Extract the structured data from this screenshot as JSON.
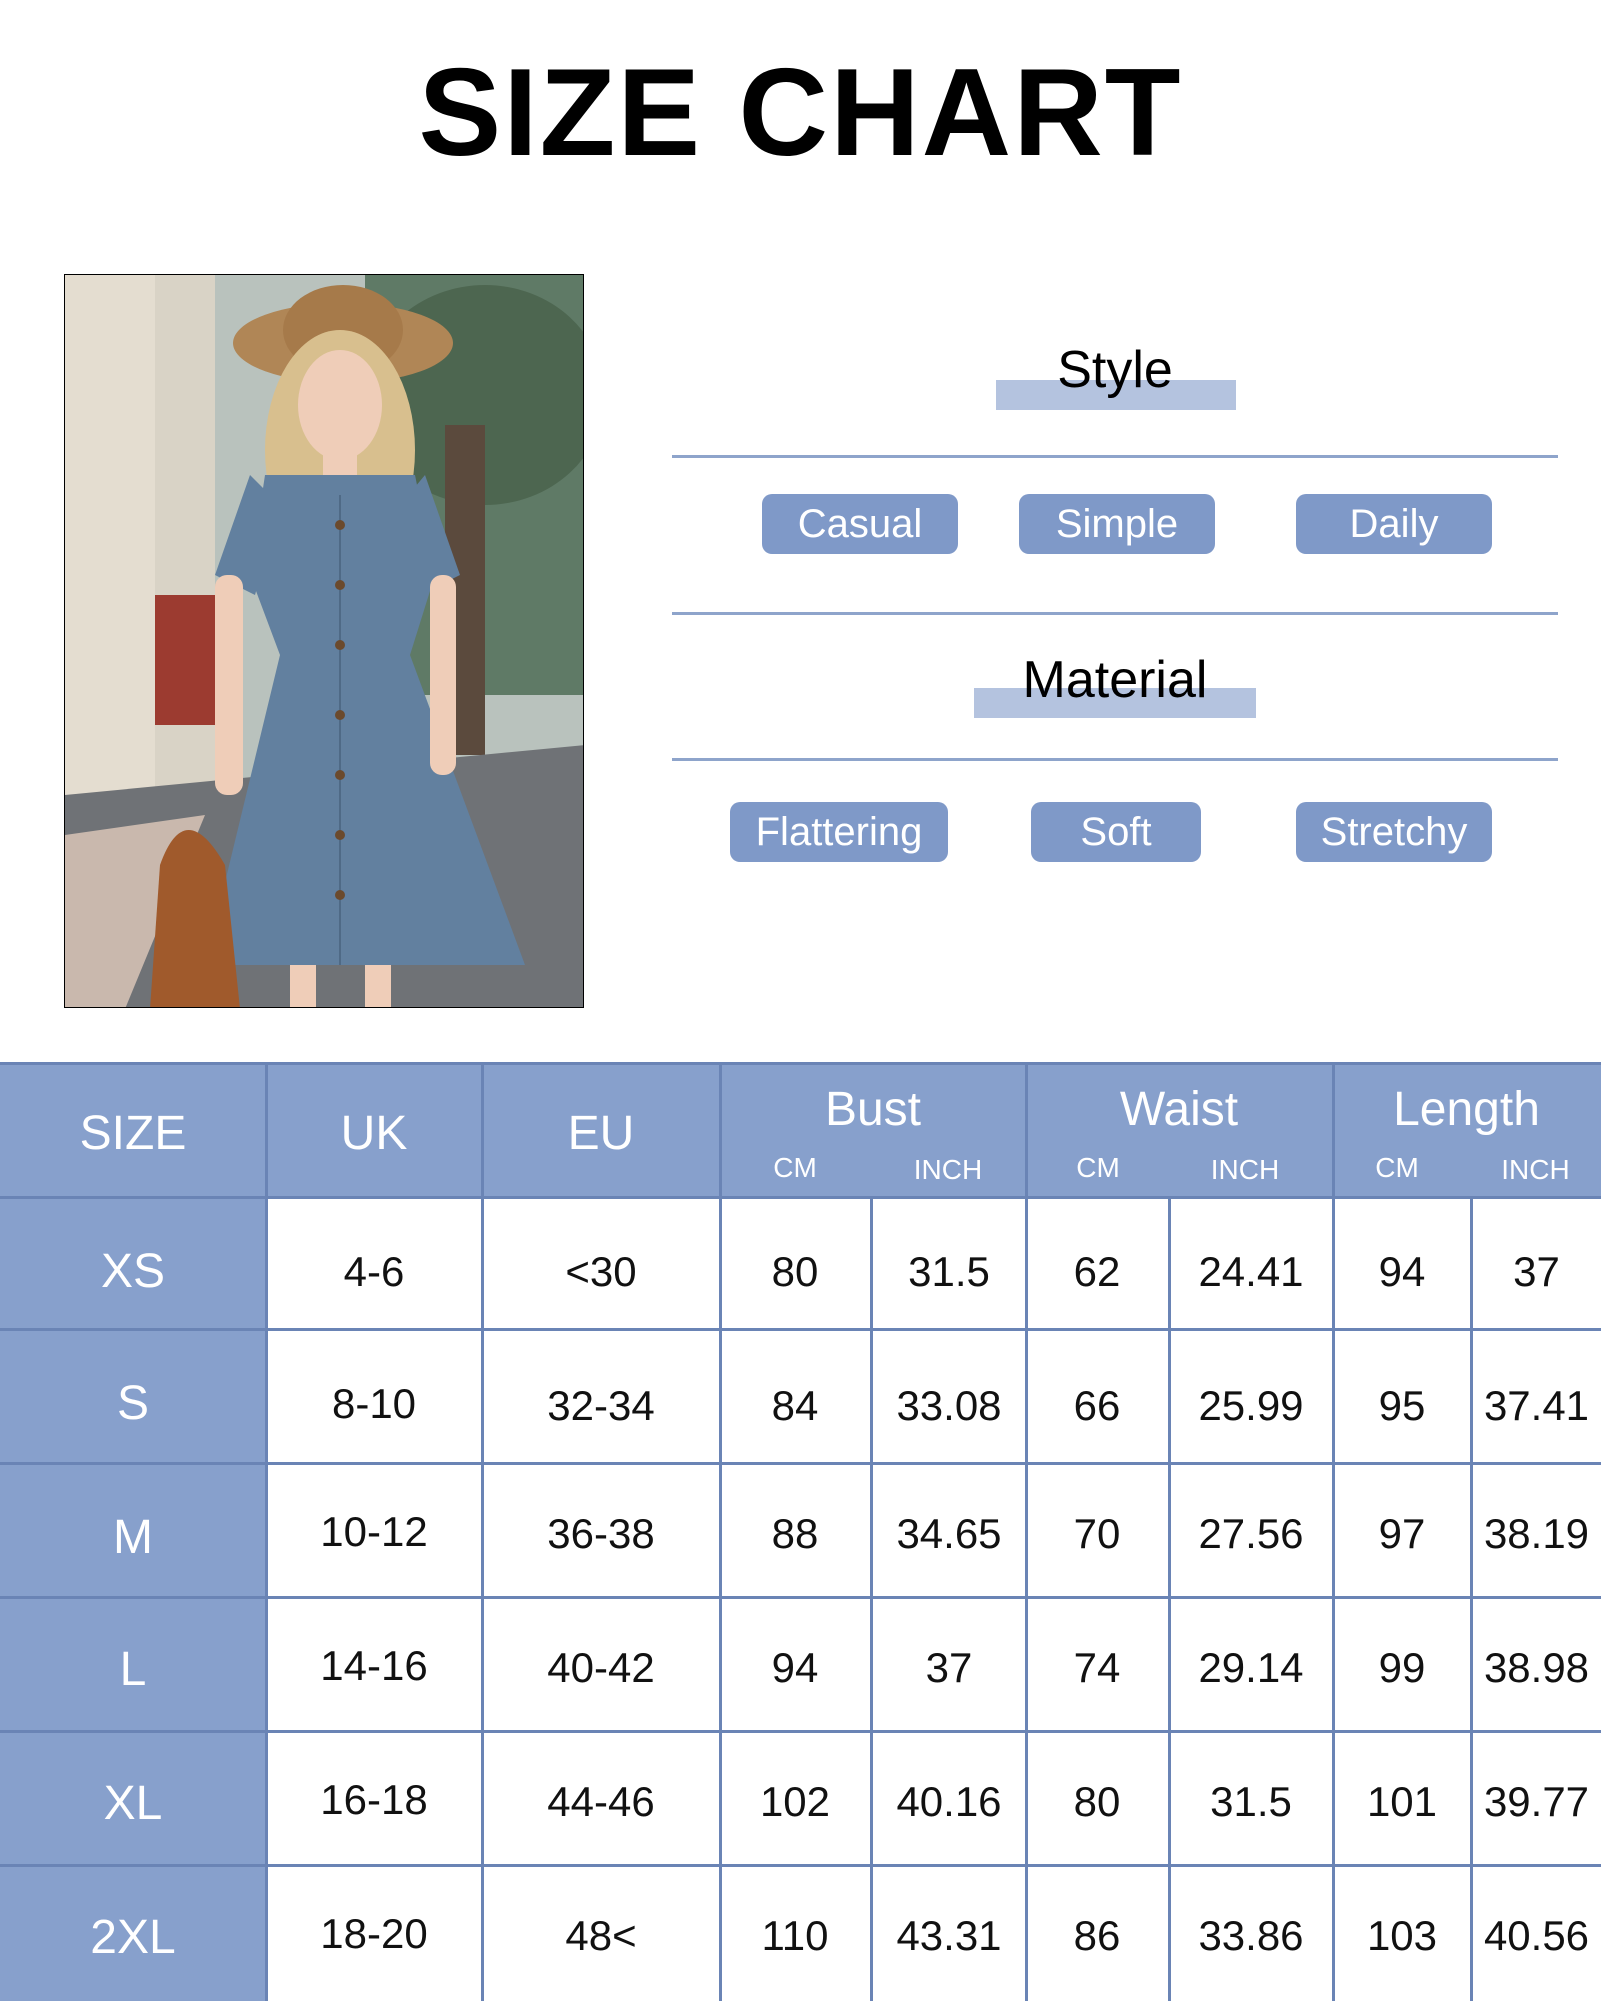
{
  "title": "SIZE CHART",
  "style_section": {
    "heading": "Style",
    "tags": [
      "Casual",
      "Simple",
      "Daily"
    ]
  },
  "material_section": {
    "heading": "Material",
    "tags": [
      "Flattering",
      "Soft",
      "Stretchy"
    ]
  },
  "photo": {
    "description_icon": "model-photo"
  },
  "colors": {
    "accent": "#87a0cc",
    "pill": "#7f99c8",
    "rule": "#8ea4cb",
    "grid": "#6a84b5"
  },
  "table": {
    "headers": {
      "size": "SIZE",
      "uk": "UK",
      "eu": "EU",
      "bust": "Bust",
      "waist": "Waist",
      "length": "Length",
      "cm": "CM",
      "inch": "INCH"
    },
    "rows": [
      {
        "size": "XS",
        "uk": "4-6",
        "eu": "<30",
        "bust_cm": "80",
        "bust_in": "31.5",
        "waist_cm": "62",
        "waist_in": "24.41",
        "len_cm": "94",
        "len_in": "37"
      },
      {
        "size": "S",
        "uk": "8-10",
        "eu": "32-34",
        "bust_cm": "84",
        "bust_in": "33.08",
        "waist_cm": "66",
        "waist_in": "25.99",
        "len_cm": "95",
        "len_in": "37.41"
      },
      {
        "size": "M",
        "uk": "10-12",
        "eu": "36-38",
        "bust_cm": "88",
        "bust_in": "34.65",
        "waist_cm": "70",
        "waist_in": "27.56",
        "len_cm": "97",
        "len_in": "38.19"
      },
      {
        "size": "L",
        "uk": "14-16",
        "eu": "40-42",
        "bust_cm": "94",
        "bust_in": "37",
        "waist_cm": "74",
        "waist_in": "29.14",
        "len_cm": "99",
        "len_in": "38.98"
      },
      {
        "size": "XL",
        "uk": "16-18",
        "eu": "44-46",
        "bust_cm": "102",
        "bust_in": "40.16",
        "waist_cm": "80",
        "waist_in": "31.5",
        "len_cm": "101",
        "len_in": "39.77"
      },
      {
        "size": "2XL",
        "uk": "18-20",
        "eu": "48<",
        "bust_cm": "110",
        "bust_in": "43.31",
        "waist_cm": "86",
        "waist_in": "33.86",
        "len_cm": "103",
        "len_in": "40.56"
      }
    ]
  }
}
